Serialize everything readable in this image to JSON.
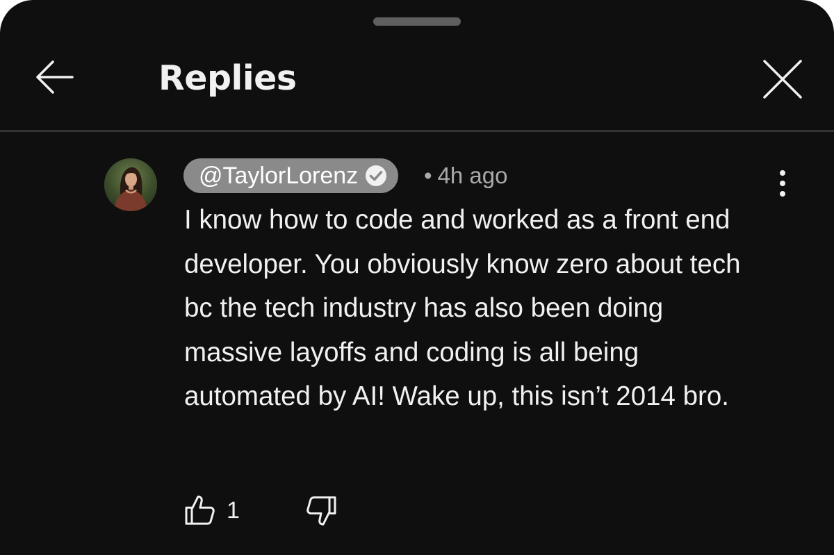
{
  "header": {
    "title": "Replies",
    "back_icon": "arrow-left-icon",
    "close_icon": "close-icon"
  },
  "comment": {
    "author": "@TaylorLorenz",
    "verified": true,
    "separator": "•",
    "timestamp": "4h ago",
    "text": "I know how to code and worked as a front end developer. You obviously know zero about tech bc the tech industry has also been doing massive layoffs and coding is all being automated by AI! Wake up, this isn’t 2014 bro.",
    "like_count": "1",
    "icons": {
      "avatar": "avatar",
      "verified": "verified-check-icon",
      "more": "more-vert-icon",
      "like": "thumbs-up-icon",
      "dislike": "thumbs-down-icon"
    }
  },
  "colors": {
    "background": "#0f0f0f",
    "text_primary": "#f1f1f1",
    "text_secondary": "#aaaaaa",
    "author_chip": "#8a8a8a",
    "divider": "#333333"
  }
}
